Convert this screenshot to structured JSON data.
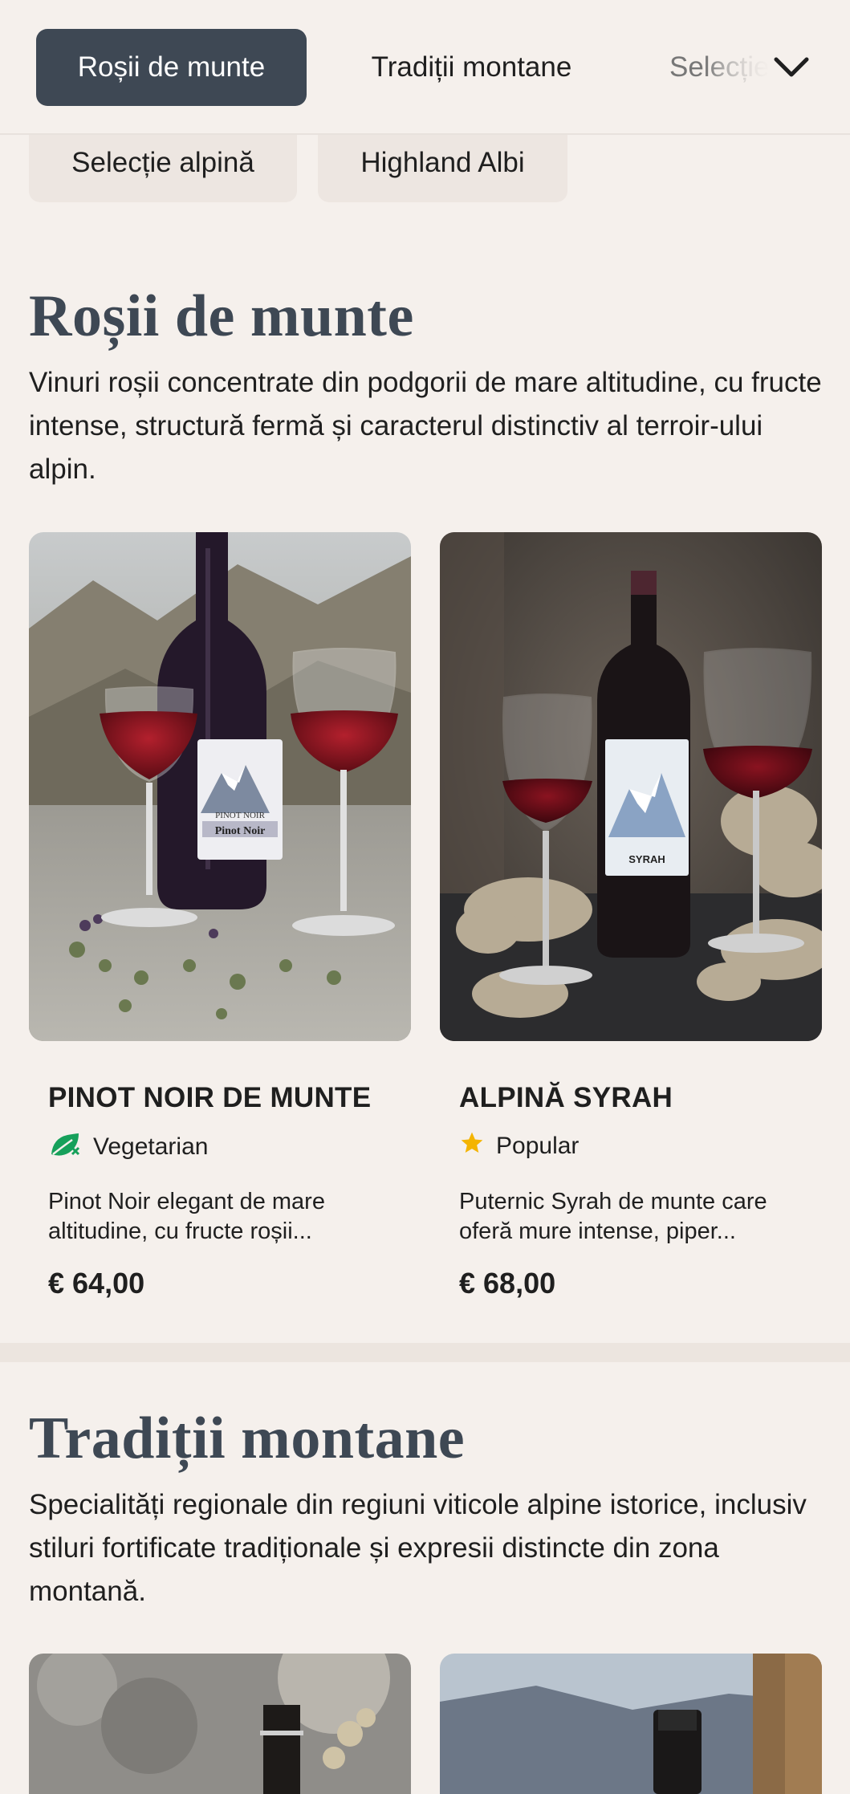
{
  "tabs": [
    {
      "label": "Roșii de munte",
      "active": true
    },
    {
      "label": "Tradiții montane",
      "active": false
    },
    {
      "label": "Selecție alpină",
      "active": false
    }
  ],
  "tabs_overflow_icon": "chevron-down-icon",
  "chips": [
    {
      "label": "Selecție alpină"
    },
    {
      "label": "Highland Albi"
    }
  ],
  "sections": [
    {
      "title": "Roșii de munte",
      "description": "Vinuri roșii concentrate din podgorii de mare altitudine, cu fructe intense, structură fermă și caracterul distinctiv al terroir-ului alpin.",
      "products": [
        {
          "name": "PINOT NOIR DE MUNTE",
          "badge": {
            "icon": "vegetarian-leaf-icon",
            "label": "Vegetarian",
            "color": "#16a05a"
          },
          "description": "Pinot Noir elegant de mare altitudine, cu fructe roșii...",
          "price": "€ 64,00",
          "label_text": {
            "line1": "PINOT NOIR",
            "line2": "Pinot Noir"
          }
        },
        {
          "name": "ALPINĂ SYRAH",
          "badge": {
            "icon": "star-icon",
            "label": "Popular",
            "color": "#f4b400"
          },
          "description": "Puternic Syrah de munte care oferă mure intense, piper...",
          "price": "€ 68,00",
          "label_text": {
            "line1": "SYRAH"
          }
        }
      ]
    },
    {
      "title": "Tradiții montane",
      "description": "Specialități regionale din regiuni viticole alpine istorice, inclusiv stiluri fortificate tradiționale și expresii distincte din zona montană."
    }
  ],
  "colors": {
    "background": "#f5f0ec",
    "active_tab": "#3e4854",
    "heading": "#3e4854",
    "chip": "#ede6e1"
  }
}
